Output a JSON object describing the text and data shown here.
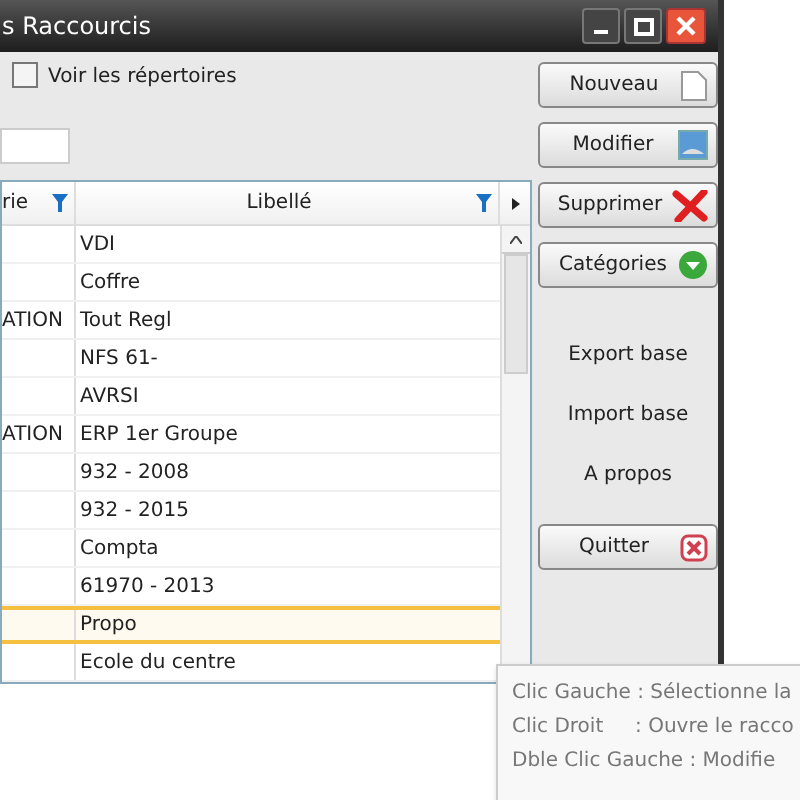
{
  "window": {
    "title": "s Raccourcis"
  },
  "show_directories": {
    "label": "Voir les répertoires",
    "checked": false
  },
  "table": {
    "columns": [
      "rie",
      "Libellé"
    ],
    "rows": [
      {
        "cells": [
          "",
          "VDI"
        ],
        "selected": false
      },
      {
        "cells": [
          "",
          "Coffre"
        ],
        "selected": false
      },
      {
        "cells": [
          "ATION",
          "Tout Regl"
        ],
        "selected": false
      },
      {
        "cells": [
          "",
          "NFS 61-"
        ],
        "selected": false
      },
      {
        "cells": [
          "",
          "AVRSI"
        ],
        "selected": false
      },
      {
        "cells": [
          "ATION",
          "ERP 1er Groupe"
        ],
        "selected": false
      },
      {
        "cells": [
          "",
          "932 - 2008"
        ],
        "selected": false
      },
      {
        "cells": [
          "",
          "932 - 2015"
        ],
        "selected": false
      },
      {
        "cells": [
          "",
          "Compta"
        ],
        "selected": false
      },
      {
        "cells": [
          "",
          "61970 - 2013"
        ],
        "selected": false
      },
      {
        "cells": [
          "",
          "Propo"
        ],
        "selected": true
      },
      {
        "cells": [
          "",
          "Ecole du centre"
        ],
        "selected": false
      }
    ]
  },
  "toolbar": [
    {
      "kind": "button",
      "label": "Nouveau"
    },
    {
      "kind": "button",
      "label": "Modifier"
    },
    {
      "kind": "button",
      "label": "Supprimer"
    },
    {
      "kind": "button",
      "label": "Catégories"
    },
    {
      "kind": "link",
      "label": "Export base"
    },
    {
      "kind": "link",
      "label": "Import base"
    },
    {
      "kind": "link",
      "label": "A propos"
    },
    {
      "kind": "button",
      "label": "Quitter"
    }
  ],
  "tooltip": [
    "Clic Gauche : Sélectionne la",
    "Clic Droit     : Ouvre le racco",
    "Dble Clic Gauche : Modifie"
  ]
}
